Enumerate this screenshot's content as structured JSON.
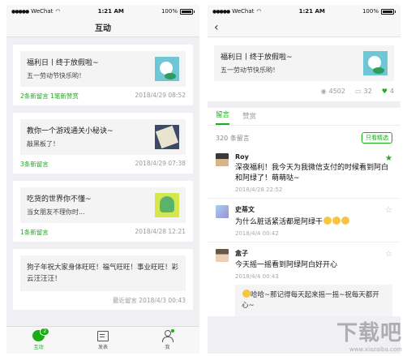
{
  "status": {
    "carrier": "WeChat",
    "time": "1:21 AM",
    "battery": "100%"
  },
  "left": {
    "title": "互动",
    "cards": [
      {
        "title": "福利日丨终于放假啦~",
        "subtitle": "五一劳动节快乐哟！",
        "meta_left": "2条新留言 1笔新赞赏",
        "date": "2018/4/29  08:52"
      },
      {
        "title": "教你一个游戏通关小秘诀~",
        "subtitle": "敲黑板了！",
        "meta_left": "3条新留言",
        "date": "2018/4/29  07:38"
      },
      {
        "title": "吃货的世界你不懂~",
        "subtitle": "当女朋友不理你时...",
        "meta_left": "1条新留言",
        "date": "2018/4/28  12:21"
      }
    ],
    "text_card": {
      "text": "狗子年祝大家身体旺旺！福气旺旺！事业旺旺！彩云汪汪汪！",
      "meta": "最近留言  2018/4/3  00:43"
    },
    "tabs": [
      {
        "label": "互动",
        "badge": "2"
      },
      {
        "label": "发表"
      },
      {
        "label": "我"
      }
    ]
  },
  "right": {
    "article": {
      "title": "福利日丨终于放假啦~",
      "subtitle": "五一劳动节快乐哟！",
      "views": "4502",
      "comments": "32",
      "likes": "4"
    },
    "tabs": [
      "留言",
      "赞赏"
    ],
    "count": "320 条留言",
    "filter": "只看精选",
    "comments": [
      {
        "name": "Roy",
        "text": "深夜福利！我今天为我微信支付的时候看到阿白和阿绿了！萌萌哒~",
        "time": "2018/4/28  22:52"
      },
      {
        "name": "史蒂文",
        "text": "为什么脏话紧活都是阿绿干",
        "time": "2018/4/4  00:42"
      },
      {
        "name": "盒子",
        "text": "今天摇一摇看到阿绿阿白好开心",
        "time": "2018/4/4  00:43"
      }
    ],
    "reply": "哈哈~那记得每天起来摇一摇~祝每天都开心~"
  },
  "watermark": {
    "big": "下载吧",
    "small": "www.xiazaiba.com"
  }
}
